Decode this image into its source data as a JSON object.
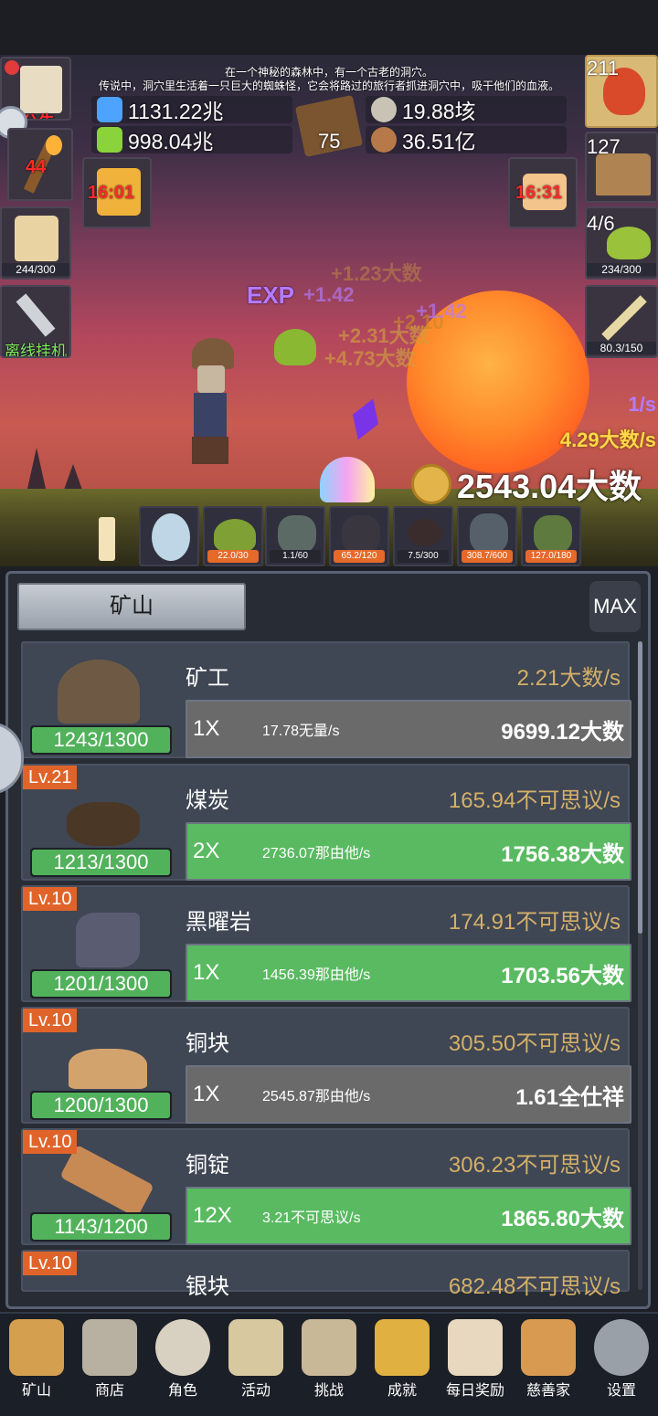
{
  "story": {
    "line1": "在一个神秘的森林中，有一个古老的洞穴。",
    "line2": "传说中，洞穴里生活着一只巨大的蜘蛛怪，它会将路过的旅行者抓进洞穴中，吸干他们的血液。"
  },
  "resources": {
    "blue_potion": "1131.22兆",
    "green_potion": "998.04兆",
    "book_level": "75",
    "silver_coin": "19.88垓",
    "meat": "36.51亿"
  },
  "left_side": {
    "notice_label": "公告",
    "torch_count": "44",
    "beer_capacity": "244/300",
    "offline_label": "离线挂机"
  },
  "right_side": {
    "potion_count": "211",
    "chest_count": "127",
    "slime_count": "4/6",
    "slime_capacity": "234/300",
    "sword_progress": "80.3/150"
  },
  "timers": {
    "left": "16:01",
    "right": "16:31"
  },
  "battle": {
    "rate_per_sec": "1/s",
    "gain_per_sec": "4.29大数/s",
    "gold_total": "2543.04大数",
    "floats": [
      "+1.42",
      "+2.10",
      "+1.42",
      "+2.31大数",
      "+4.73大数",
      "+1.23大数"
    ],
    "exp_label": "EXP"
  },
  "tray": [
    {
      "icon": "candle-icon",
      "count": ""
    },
    {
      "icon": "egg-icon",
      "count": ""
    },
    {
      "icon": "slime-icon",
      "count": "22.0/30"
    },
    {
      "icon": "ghoul-icon",
      "count": "1.1/60"
    },
    {
      "icon": "fairy-icon",
      "count": "65.2/120"
    },
    {
      "icon": "spider-icon",
      "count": "7.5/300"
    },
    {
      "icon": "wraith-icon",
      "count": "308.7/600"
    },
    {
      "icon": "orc-icon",
      "count": "127.0/180"
    }
  ],
  "panel": {
    "tab_label": "矿山",
    "max_label": "MAX"
  },
  "mines": [
    {
      "name": "矿工",
      "level": "",
      "capacity": "1243/1300",
      "rate": "2.21大数/s",
      "mult": "1X",
      "per": "17.78无量/s",
      "cost": "9699.12大数",
      "affordable": false,
      "icon": "miner-helmet-icon"
    },
    {
      "name": "煤炭",
      "level": "Lv.21",
      "capacity": "1213/1300",
      "rate": "165.94不可思议/s",
      "mult": "2X",
      "per": "2736.07那由他/s",
      "cost": "1756.38大数",
      "affordable": true,
      "icon": "coal-icon"
    },
    {
      "name": "黑曜岩",
      "level": "Lv.10",
      "capacity": "1201/1300",
      "rate": "174.91不可思议/s",
      "mult": "1X",
      "per": "1456.39那由他/s",
      "cost": "1703.56大数",
      "affordable": true,
      "icon": "obsidian-icon"
    },
    {
      "name": "铜块",
      "level": "Lv.10",
      "capacity": "1200/1300",
      "rate": "305.50不可思议/s",
      "mult": "1X",
      "per": "2545.87那由他/s",
      "cost": "1.61全仕祥",
      "affordable": false,
      "icon": "copper-ore-icon"
    },
    {
      "name": "铜锭",
      "level": "Lv.10",
      "capacity": "1143/1200",
      "rate": "306.23不可思议/s",
      "mult": "12X",
      "per": "3.21不可思议/s",
      "cost": "1865.80大数",
      "affordable": true,
      "icon": "copper-ingot-icon"
    },
    {
      "name": "银块",
      "level": "Lv.10",
      "capacity": "",
      "rate": "682.48不可思议/s",
      "mult": "",
      "per": "",
      "cost": "",
      "affordable": false,
      "icon": "silver-ore-icon"
    }
  ],
  "nav": [
    {
      "label": "矿山",
      "icon": "lantern-icon"
    },
    {
      "label": "商店",
      "icon": "shop-stone-icon"
    },
    {
      "label": "角色",
      "icon": "skull-icon"
    },
    {
      "label": "活动",
      "icon": "scroll-icon"
    },
    {
      "label": "挑战",
      "icon": "map-icon"
    },
    {
      "label": "成就",
      "icon": "key-icon"
    },
    {
      "label": "每日奖励",
      "icon": "envelope-icon"
    },
    {
      "label": "慈善家",
      "icon": "bread-icon"
    },
    {
      "label": "设置",
      "icon": "gear-icon"
    }
  ],
  "colors": {
    "accent_green": "#5aba62",
    "level_orange": "#e0642a",
    "rate_gold": "#d4b068",
    "timer_red": "#ff2a2a"
  }
}
